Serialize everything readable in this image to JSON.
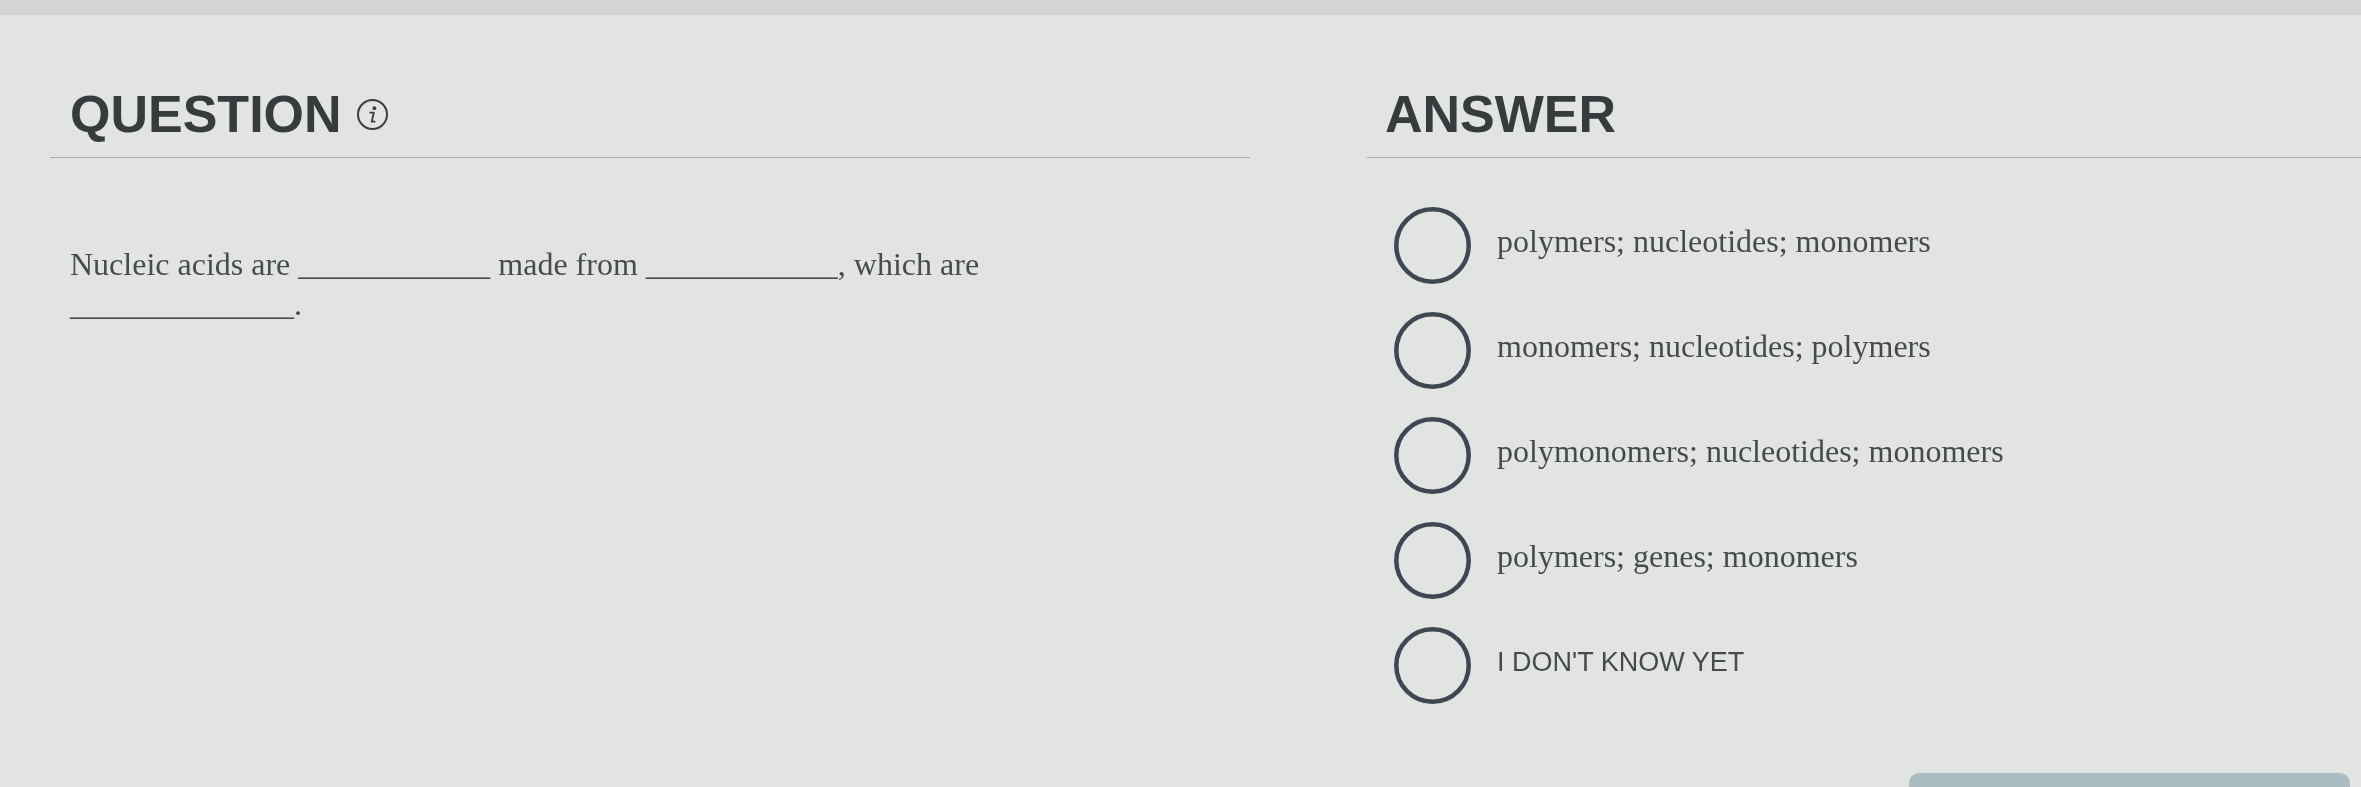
{
  "question": {
    "heading": "QUESTION",
    "text": "Nucleic acids are ____________ made from ____________, which are ______________."
  },
  "answer": {
    "heading": "ANSWER",
    "options": [
      {
        "label": "polymers; nucleotides; monomers",
        "kind": "choice",
        "selected": false
      },
      {
        "label": "monomers; nucleotides; polymers",
        "kind": "choice",
        "selected": false
      },
      {
        "label": "polymonomers; nucleotides; monomers",
        "kind": "choice",
        "selected": false
      },
      {
        "label": "polymers; genes; monomers",
        "kind": "choice",
        "selected": false
      },
      {
        "label": "I DON'T KNOW YET",
        "kind": "unsure",
        "selected": false
      }
    ]
  }
}
